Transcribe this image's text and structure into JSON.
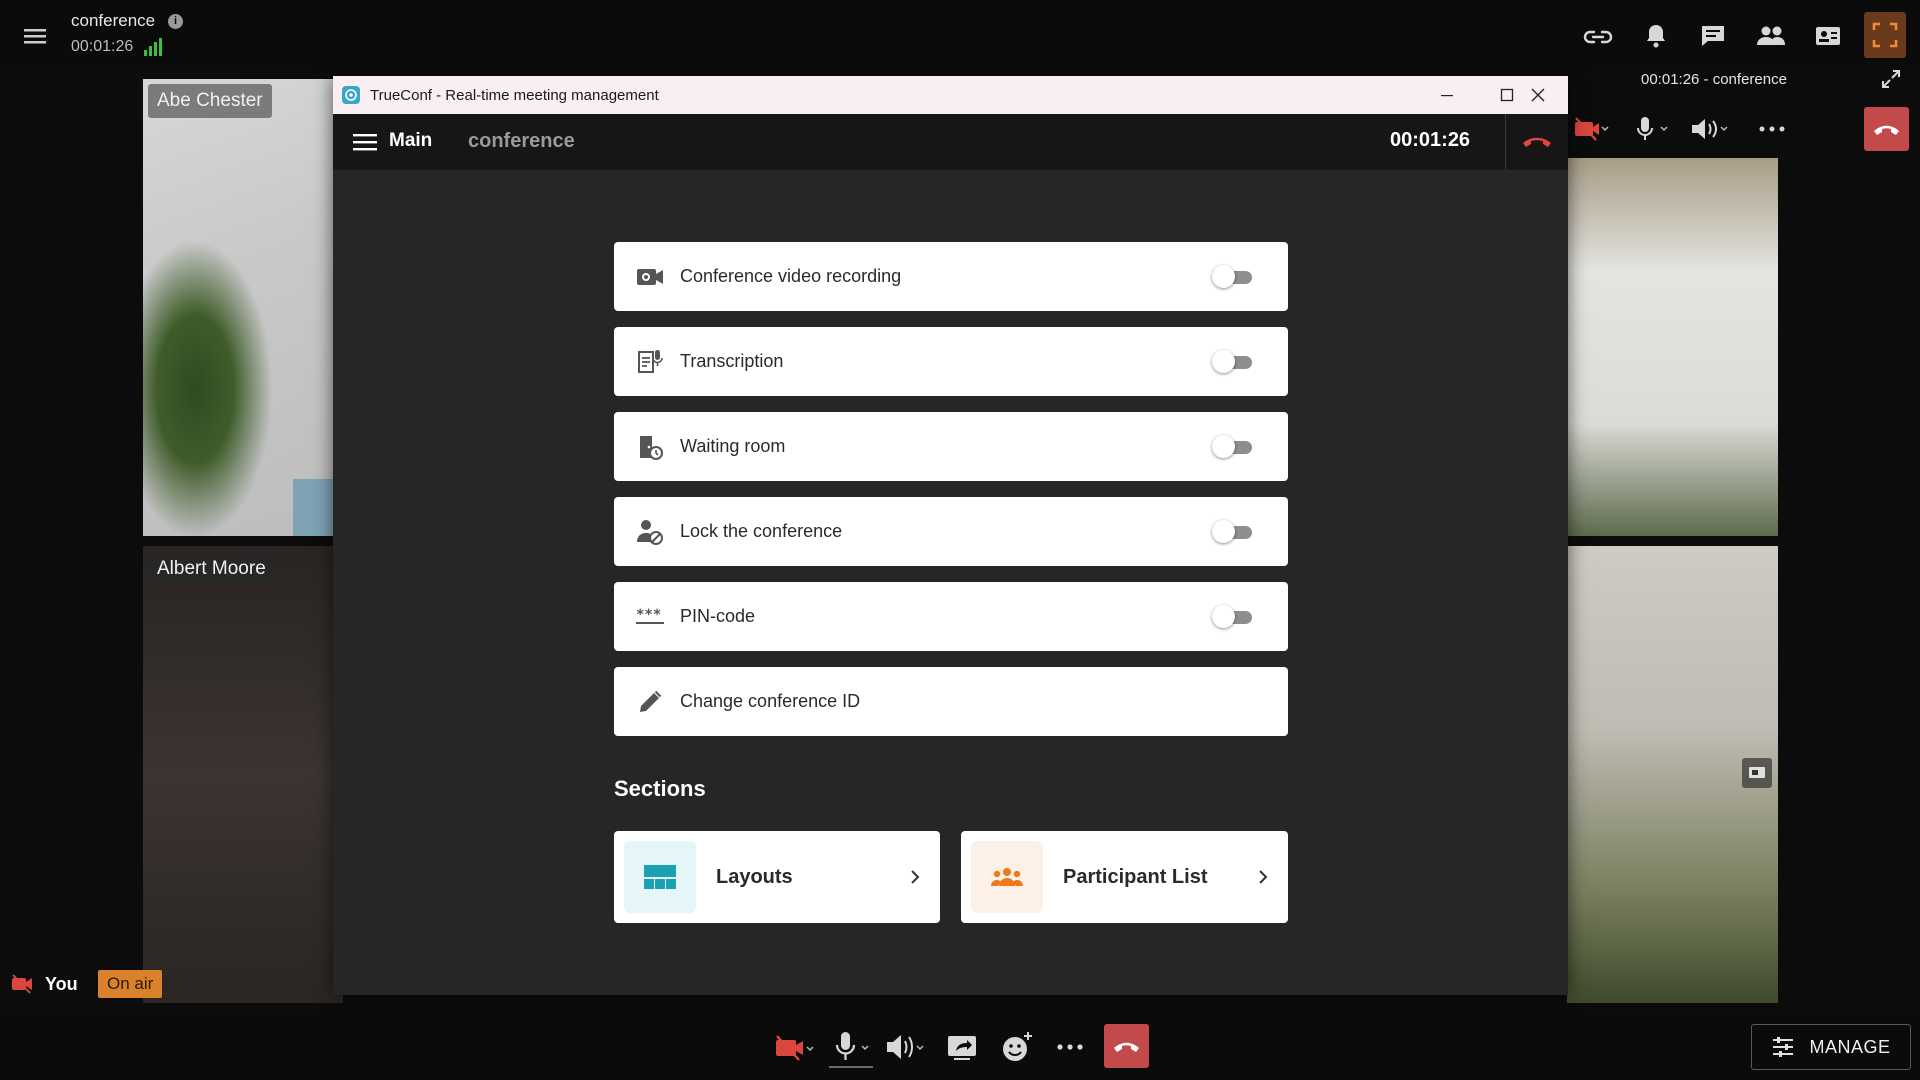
{
  "app": {
    "conference_name": "conference",
    "elapsed": "00:01:26",
    "right_panel_title": "00:01:26 - conference",
    "manage_label": "MANAGE",
    "self_label": "You",
    "on_air_label": "On air"
  },
  "participants": [
    {
      "name": "Abe Chester"
    },
    {
      "name": "Albert Moore"
    }
  ],
  "dialog": {
    "window_title": "TrueConf - Real-time meeting management",
    "header_main": "Main",
    "header_conference": "conference",
    "header_time": "00:01:26",
    "settings": [
      {
        "label": "Conference video recording",
        "icon": "video-record-icon",
        "toggle": false
      },
      {
        "label": "Transcription",
        "icon": "transcription-icon",
        "toggle": false
      },
      {
        "label": "Waiting room",
        "icon": "waiting-room-icon",
        "toggle": false
      },
      {
        "label": "Lock the conference",
        "icon": "lock-user-icon",
        "toggle": false
      },
      {
        "label": "PIN-code",
        "icon": "pin-code-icon",
        "toggle": false
      },
      {
        "label": "Change conference ID",
        "icon": "edit-pencil-icon"
      }
    ],
    "sections_title": "Sections",
    "sections": [
      {
        "label": "Layouts",
        "icon": "layouts-icon",
        "color": "#1aa1b2"
      },
      {
        "label": "Participant List",
        "icon": "participants-icon",
        "color": "#f07a1a"
      }
    ]
  },
  "colors": {
    "hangup": "#c34a4a",
    "on_air": "#d9822b",
    "accent_orange": "#e8852a",
    "signal_green": "#3cc23c"
  }
}
